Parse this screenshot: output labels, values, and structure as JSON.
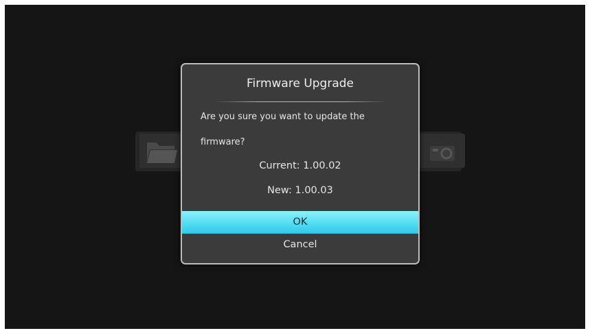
{
  "dialog": {
    "title": "Firmware Upgrade",
    "message": "Are you sure you want to update the firmware?",
    "current_version": "Current: 1.00.02",
    "new_version": "New: 1.00.03",
    "ok_label": "OK",
    "cancel_label": "Cancel"
  },
  "background": {
    "icons": [
      "folder-icon",
      "settings-icon"
    ]
  },
  "colors": {
    "screen_bg": "#151515",
    "dialog_bg": "#3b3b3b",
    "dialog_border": "#bdbdbd",
    "selection": "#57dff3"
  }
}
